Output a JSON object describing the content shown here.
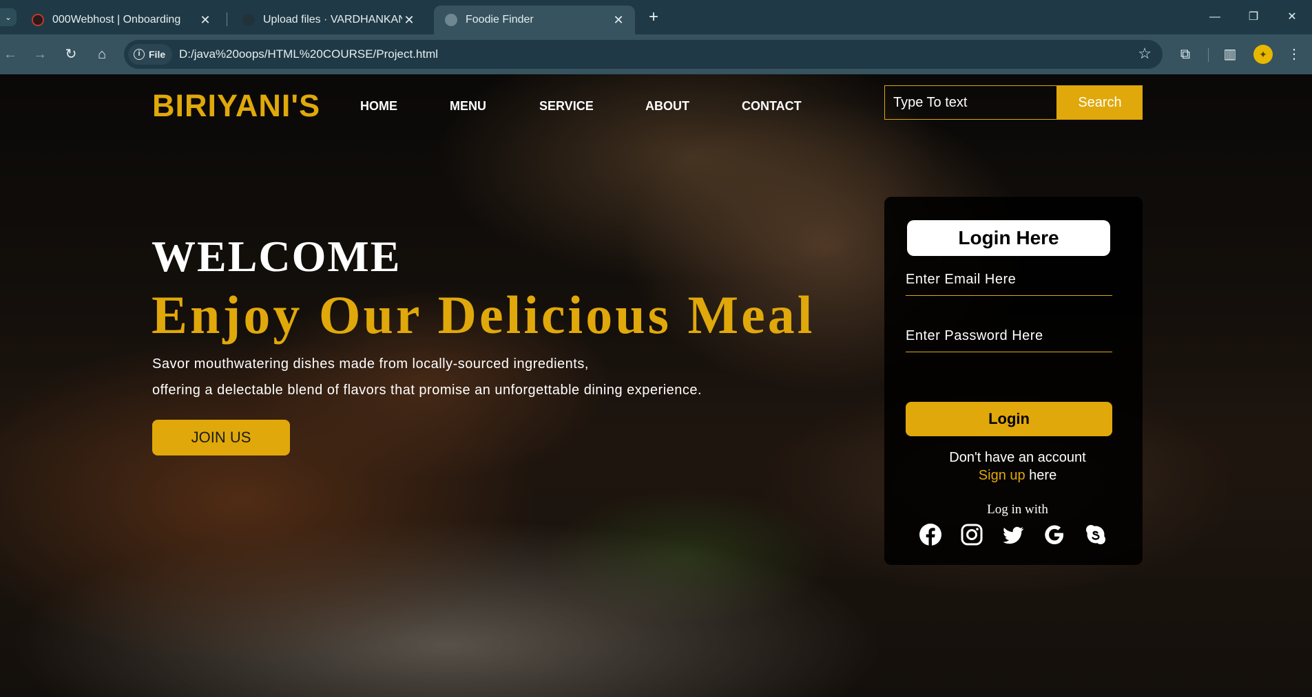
{
  "browser": {
    "tabs": [
      {
        "title": "000Webhost | Onboarding",
        "active": false
      },
      {
        "title": "Upload files · VARDHANKANDA",
        "active": false
      },
      {
        "title": "Foodie Finder",
        "active": true
      }
    ],
    "chip_label": "File",
    "url": "D:/java%20oops/HTML%20COURSE/Project.html"
  },
  "site": {
    "logo": "BIRIYANI'S",
    "nav": [
      "HOME",
      "MENU",
      "SERVICE",
      "ABOUT",
      "CONTACT"
    ],
    "search": {
      "placeholder": "Type To text",
      "button": "Search"
    }
  },
  "hero": {
    "welcome": "WELCOME",
    "headline": "Enjoy Our Delicious Meal",
    "desc_line1": "Savor mouthwatering dishes made from locally-sourced ingredients,",
    "desc_line2": "offering a delectable blend of flavors that promise an unforgettable dining experience.",
    "join_button": "JOIN US"
  },
  "login": {
    "title": "Login Here",
    "email_placeholder": "Enter Email Here",
    "password_placeholder": "Enter Password Here",
    "button": "Login",
    "no_account": "Don't have an account",
    "signup_link": "Sign up",
    "signup_suffix": " here",
    "login_with": "Log in with",
    "socials": [
      "facebook-icon",
      "instagram-icon",
      "twitter-icon",
      "google-icon",
      "skype-icon"
    ]
  },
  "colors": {
    "accent": "#e0a80a",
    "chrome_dark": "#1f3a46",
    "chrome_light": "#36535f"
  }
}
